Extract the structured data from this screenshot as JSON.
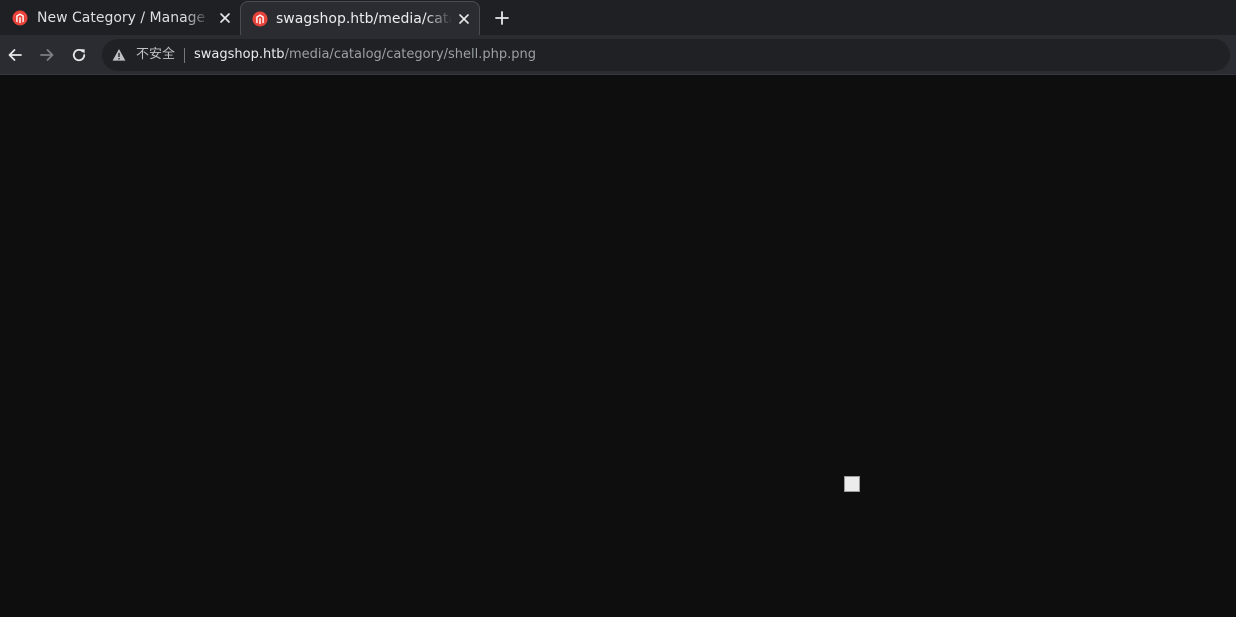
{
  "tabs": [
    {
      "title": "New Category / Manage Categories / Categories / Catalog / Magento Admin",
      "favicon": "magento-icon",
      "active": false
    },
    {
      "title": "swagshop.htb/media/catalog/category/shell.php.png",
      "favicon": "magento-icon",
      "active": true
    }
  ],
  "toolbar": {
    "back": "back-arrow-icon",
    "forward": "forward-arrow-icon",
    "reload": "reload-icon"
  },
  "omnibox": {
    "security_icon": "warning-icon",
    "security_label": "不安全",
    "url_host": "swagshop.htb",
    "url_path": "/media/catalog/category/shell.php.png"
  },
  "page": {
    "content": "broken-image-icon"
  },
  "colors": {
    "tabstrip": "#1f2023",
    "toolbar": "#2b2c31",
    "omnibox": "#202124",
    "page_background": "#0e0e0f",
    "favicon": "#e8433b"
  }
}
